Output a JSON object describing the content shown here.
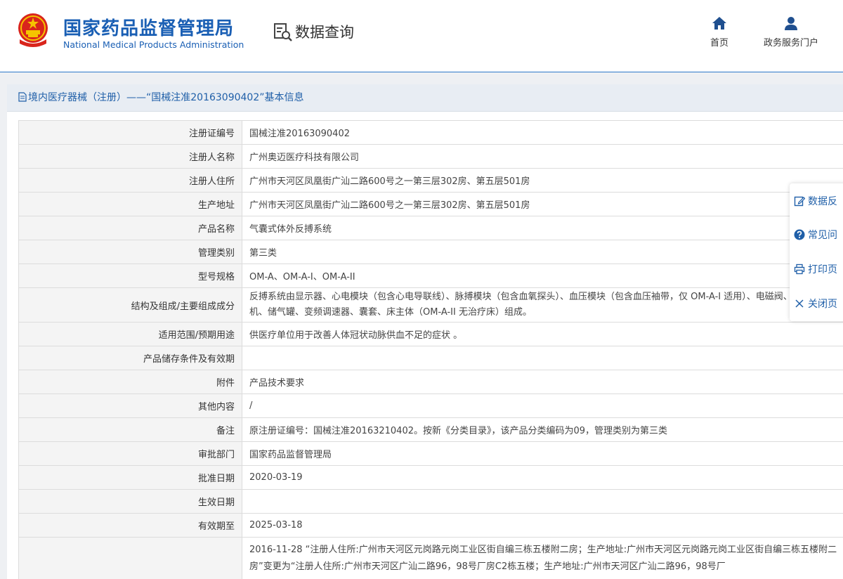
{
  "header": {
    "org_name_cn": "国家药品监督管理局",
    "org_name_en": "National Medical Products Administration",
    "query_title": "数据查询",
    "nav": {
      "home_label": "首页",
      "portal_label": "政务服务门户"
    }
  },
  "panel": {
    "title": "境内医疗器械（注册）——“国械注准20163090402”基本信息"
  },
  "rows": [
    {
      "label": "注册证编号",
      "value": "国械注准20163090402"
    },
    {
      "label": "注册人名称",
      "value": "广州奥迈医疗科技有限公司"
    },
    {
      "label": "注册人住所",
      "value": "广州市天河区凤凰街广汕二路600号之一第三层302房、第五层501房"
    },
    {
      "label": "生产地址",
      "value": "广州市天河区凤凰街广汕二路600号之一第三层302房、第五层501房"
    },
    {
      "label": "产品名称",
      "value": "气囊式体外反搏系统"
    },
    {
      "label": "管理类别",
      "value": "第三类"
    },
    {
      "label": "型号规格",
      "value": "OM-A、OM-A-I、OM-A-II"
    },
    {
      "label": "结构及组成/主要组成成分",
      "value": "反搏系统由显示器、心电模块（包含心电导联线）、脉搏模块（包含血氧探头）、血压模块（包含血压袖带，仅 OM-A-I 适用）、电磁阀、空气压缩机、储气罐、变频调速器、囊套、床主体（OM-A-II 无治疗床）组成。"
    },
    {
      "label": "适用范围/预期用途",
      "value": "供医疗单位用于改善人体冠状动脉供血不足的症状 。"
    },
    {
      "label": "产品储存条件及有效期",
      "value": ""
    },
    {
      "label": "附件",
      "value": "产品技术要求"
    },
    {
      "label": "其他内容",
      "value": "/"
    },
    {
      "label": "备注",
      "value": "原注册证编号：国械注准20163210402。按新《分类目录》，该产品分类编码为09，管理类别为第三类"
    },
    {
      "label": "审批部门",
      "value": "国家药品监督管理局"
    },
    {
      "label": "批准日期",
      "value": "2020-03-19"
    },
    {
      "label": "生效日期",
      "value": ""
    },
    {
      "label": "有效期至",
      "value": "2025-03-18"
    },
    {
      "label": "",
      "value": "2016-11-28 “注册人住所:广州市天河区元岗路元岗工业区街自编三栋五楼附二房；生产地址:广州市天河区元岗路元岗工业区街自编三栋五楼附二房”变更为“注册人住所:广州市天河区广汕二路96，98号厂房C2栋五楼；生产地址:广州市天河区广汕二路96，98号厂"
    }
  ],
  "side_toolbar": {
    "feedback_label": "数据反",
    "faq_label": "常见问",
    "print_label": "打印页",
    "close_label": "关闭页"
  },
  "colors": {
    "brand_blue": "#1a5fb4",
    "link_blue": "#1f5fa8",
    "label_bg": "#f4f4f4",
    "title_bar_bg": "#e8edf3"
  }
}
